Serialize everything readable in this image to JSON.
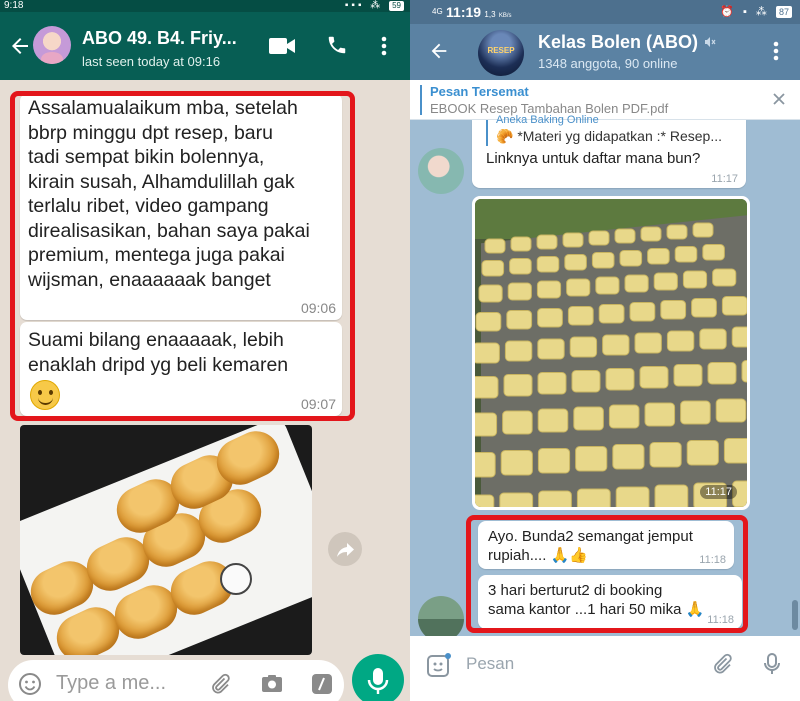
{
  "whatsapp": {
    "status": {
      "time": "9:18",
      "battery": "59"
    },
    "header": {
      "title": "ABO 49. B4. Friy...",
      "subtitle": "last seen today at 09:16"
    },
    "messages": [
      {
        "text": "Assalamualaikum mba, setelah\nbbrp minggu dpt resep, baru\ntadi sempat bikin bolennya,\nkirain susah, Alhamdulillah gak\nterlalu ribet, video gampang\ndirealisasikan, bahan saya pakai\npremium, mentega juga pakai\nwijsman, enaaaaaak banget",
        "time": "09:06"
      },
      {
        "text": "Suami bilang enaaaaak, lebih\nenaklah dripd yg beli kemaren",
        "time": "09:07",
        "emoji": "smiling-face-icon"
      }
    ],
    "input": {
      "placeholder": "Type a me..."
    },
    "icons": [
      "back-arrow-icon",
      "video-call-icon",
      "phone-icon",
      "more-vert-icon",
      "share-icon",
      "emoji-icon",
      "paperclip-icon",
      "camera-icon",
      "payment-icon",
      "mic-icon"
    ],
    "colors": {
      "header": "#075e54",
      "chat_bg": "#e6ddd4",
      "mic": "#00a884",
      "highlight": "#e3161b"
    }
  },
  "telegram": {
    "status": {
      "time": "11:19",
      "network": "4G",
      "speed": "1,3",
      "speed_unit": "KB/s",
      "battery": "87"
    },
    "header": {
      "title": "Kelas Bolen (ABO)",
      "subtitle": "1348 anggota, 90 online",
      "avatar_text": "RESEP"
    },
    "pinned": {
      "title": "Pesan Tersemat",
      "text": "EBOOK Resep Tambahan Bolen PDF.pdf"
    },
    "messages": [
      {
        "reply_name": "Aneka Baking Online",
        "reply_text": "🥐 *Materi yg didapatkan :* Resep...",
        "text": "Linknya untuk daftar mana bun?",
        "time": "11:17"
      },
      {
        "type": "photo",
        "time": "11:17"
      },
      {
        "text": "Ayo. Bunda2 semangat jemput\nrupiah.... 🙏👍",
        "time": "11:18"
      },
      {
        "text": "3 hari berturut2 di booking\nsama kantor ...1 hari 50 mika 🙏",
        "time": "11:18"
      }
    ],
    "input": {
      "placeholder": "Pesan"
    },
    "icons": [
      "back-arrow-icon",
      "mute-icon",
      "more-vert-icon",
      "close-icon",
      "sticker-icon",
      "paperclip-icon",
      "mic-icon"
    ],
    "colors": {
      "header": "#5b82a3",
      "chat_bg": "#9fbcd3",
      "accent": "#3a8fd0",
      "highlight": "#e3161b"
    }
  }
}
